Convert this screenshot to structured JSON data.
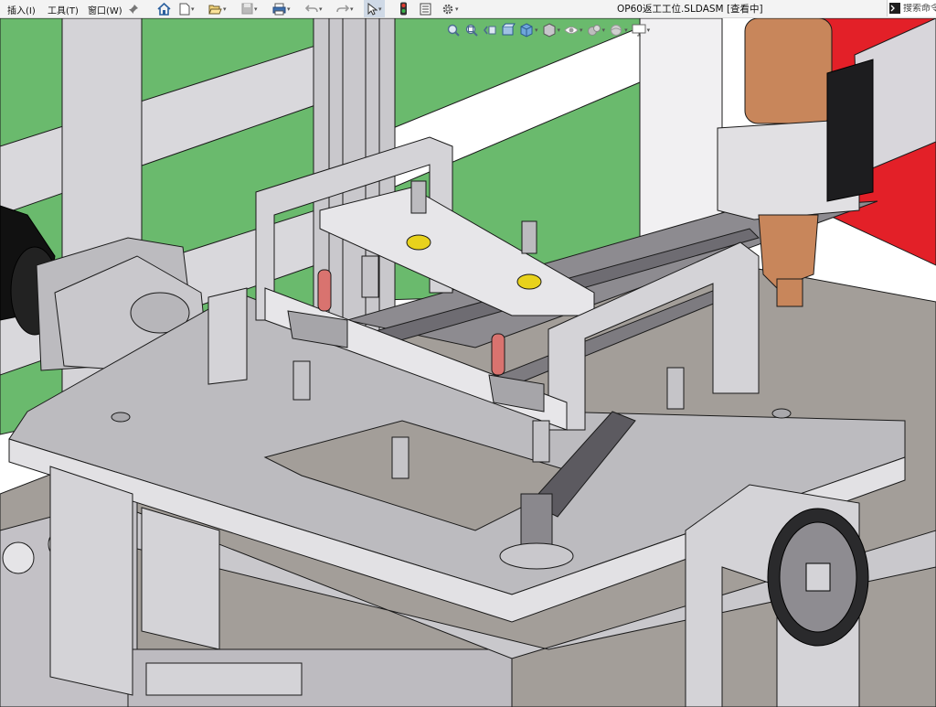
{
  "menu": {
    "insert": "插入(I)",
    "tools": "工具(T)",
    "window": "窗口(W)"
  },
  "toolbar": {
    "icons": [
      "home-icon",
      "new-document-icon",
      "open-icon",
      "save-icon",
      "print-icon",
      "undo-icon",
      "redo-icon",
      "select-cursor-icon",
      "traffic-light-icon",
      "file-properties-icon",
      "options-gear-icon"
    ]
  },
  "document": {
    "title": "OP60返工工位.SLDASM [查看中]"
  },
  "search": {
    "placeholder": "搜索命令"
  },
  "heads_up_toolbar": {
    "icons": [
      "zoom-to-fit-icon",
      "zoom-area-icon",
      "previous-view-icon",
      "section-view-icon",
      "view-orientation-icon",
      "display-style-icon",
      "hide-show-items-icon",
      "edit-appearance-icon",
      "apply-scene-icon",
      "view-settings-icon"
    ]
  },
  "colors": {
    "background_green": "#6aba6d",
    "rail_red": "#e32028",
    "part_gray": "#c8c6cb",
    "table_gray": "#bcbbbf",
    "floor_taupe": "#a39e99",
    "clamp_red": "#d9736f",
    "bushing_yellow": "#e8d21c",
    "spindle_copper": "#c8865b",
    "edge_black": "#1a1a1a"
  }
}
